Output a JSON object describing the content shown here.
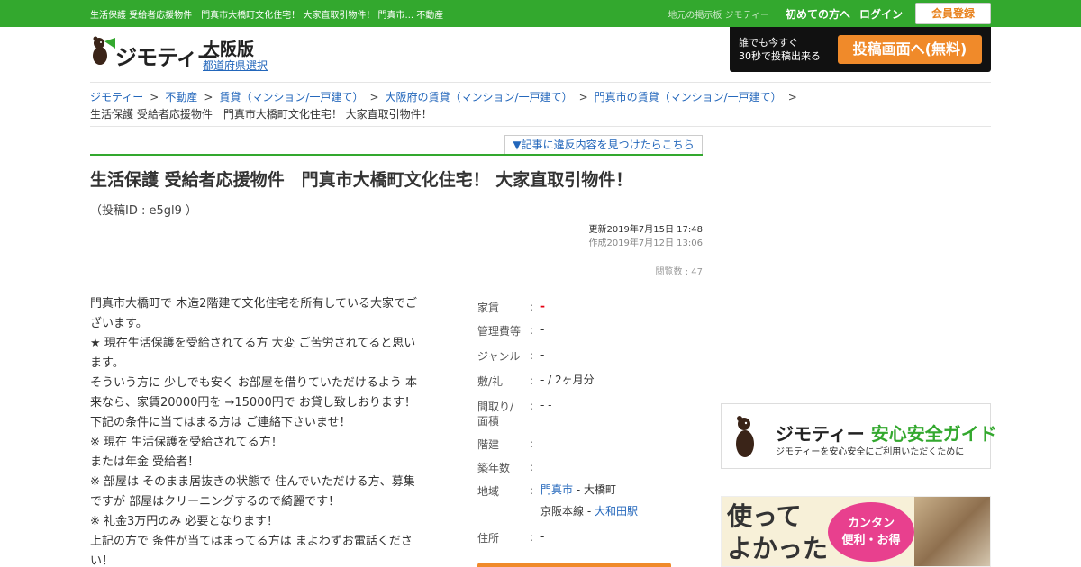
{
  "topbar": {
    "page_text": "生活保護 受給者応援物件　門真市大橋町文化住宅！ 大家直取引物件！ 門真市... 不動産",
    "tagline": "地元の掲示板 ジモティー",
    "first_time": "初めての方へ",
    "login": "ログイン",
    "register": "会員登録"
  },
  "logo": {
    "brand": "ジモティー",
    "region": "大阪版",
    "prefecture_select": "都道府県選択"
  },
  "post_banner": {
    "line1": "誰でも今すぐ",
    "line2": "30秒で投稿出来る",
    "button": "投稿画面へ(無料)"
  },
  "breadcrumb": {
    "items": [
      "ジモティー",
      "不動産",
      "賃貸（マンション/一戸建て）",
      "大阪府の賃貸（マンション/一戸建て）",
      "門真市の賃貸（マンション/一戸建て）"
    ],
    "separator": ">",
    "current": "生活保護 受給者応援物件　門真市大橋町文化住宅！ 大家直取引物件！"
  },
  "report_link": "▼記事に違反内容を見つけたらこちら",
  "post": {
    "title": "生活保護 受給者応援物件　門真市大橋町文化住宅！ 大家直取引物件！",
    "post_id": "（投稿ID : e5gl9 ）",
    "updated": "更新2019年7月15日 17:48",
    "created": "作成2019年7月12日 13:06",
    "views": "閲覧数 : 47",
    "body_lines": [
      "門真市大橋町で 木造2階建て文化住宅を所有している大家でご",
      "ざいます。",
      "★ 現在生活保護を受給されてる方 大変 ご苦労されてると思い",
      "ます。",
      "そういう方に 少しでも安く お部屋を借りていただけるよう 本",
      "来なら、家賃20000円を →15000円で お貸し致しおります！",
      "下記の条件に当てはまる方は ご連絡下さいませ！",
      "※ 現在 生活保護を受給されてる方！",
      "または年金 受給者！",
      "※ 部屋は そのまま居抜きの状態で 住んでいただける方、募集",
      "ですが 部屋はクリーニングするので綺麗です！",
      "※ 礼金3万円のみ 必要となります！",
      "上記の方で 条件が当てはまってる方は まよわずお電話くださ",
      "い！"
    ]
  },
  "spec": {
    "colon": ":",
    "rent_label": "家賃",
    "rent_value": "-",
    "fee_label": "管理費等",
    "fee_value": "-",
    "genre_label": "ジャンル",
    "genre_value": "-",
    "deposit_label": "敷/礼",
    "deposit_value": "- / 2ヶ月分",
    "layout_label": "間取り/面積",
    "layout_value": "- -",
    "floor_label": "階建",
    "floor_value": "",
    "age_label": "築年数",
    "age_value": "",
    "area_label": "地域",
    "area_city": "門真市",
    "area_rest": " - 大橋町",
    "area_line": "京阪本線 - ",
    "area_station": "大和田駅",
    "address_label": "住所",
    "address_value": "-"
  },
  "guide": {
    "brand": "ジモティー",
    "title": "安心安全ガイド",
    "subtitle": "ジモティーを安心安全にご利用いただくために"
  },
  "promo": {
    "line1": "使って",
    "line2": "よかった",
    "bubble1": "カンタン",
    "bubble2": "便利・お得"
  },
  "colors": {
    "green": "#33a82e",
    "orange": "#f08a2a",
    "link": "#2266bb",
    "red": "#e60012"
  }
}
